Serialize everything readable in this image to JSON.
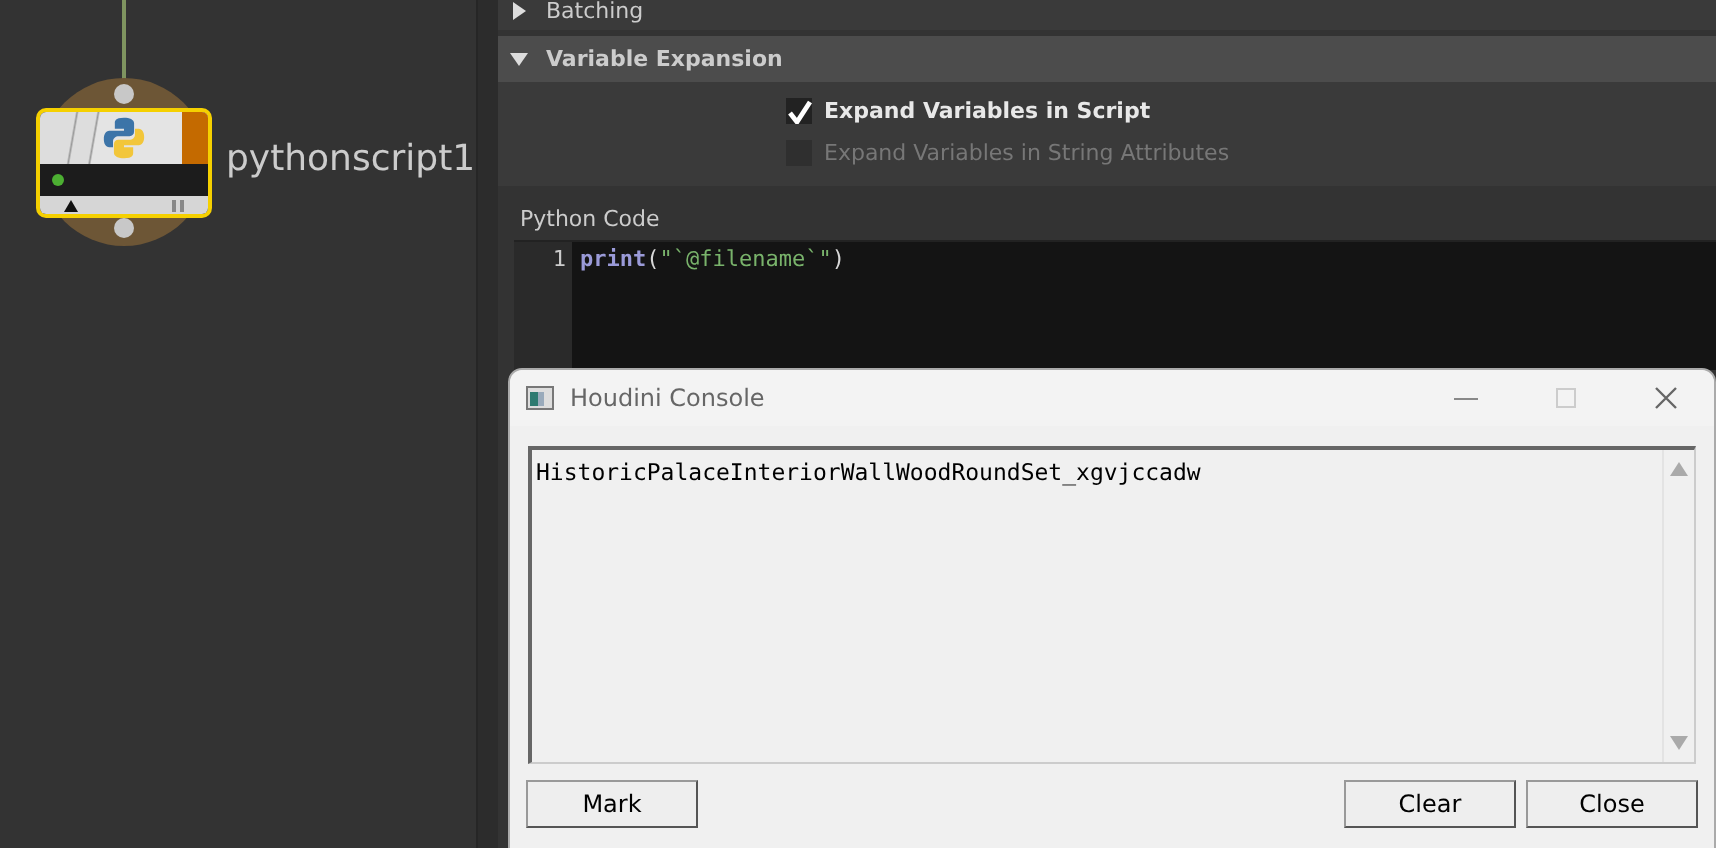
{
  "network": {
    "node": {
      "name": "pythonscript1",
      "selected": true
    }
  },
  "parameters": {
    "sections": [
      {
        "title": "Batching",
        "expanded": false
      },
      {
        "title": "Variable Expansion",
        "expanded": true,
        "options": [
          {
            "label": "Expand Variables in Script",
            "checked": true,
            "disabled": false
          },
          {
            "label": "Expand Variables in String Attributes",
            "checked": false,
            "disabled": true
          }
        ]
      }
    ],
    "code_label": "Python Code",
    "code_lines": [
      {
        "number": "1",
        "tokens": [
          {
            "kind": "keyword",
            "text": "print"
          },
          {
            "kind": "punct",
            "text": "("
          },
          {
            "kind": "string",
            "text": "\"`@filename`\""
          },
          {
            "kind": "punct",
            "text": ")"
          }
        ]
      }
    ]
  },
  "console": {
    "title": "Houdini Console",
    "output": "HistoricPalaceInteriorWallWoodRoundSet_xgvjccadw",
    "buttons": [
      "Mark",
      "Clear",
      "Close"
    ]
  }
}
